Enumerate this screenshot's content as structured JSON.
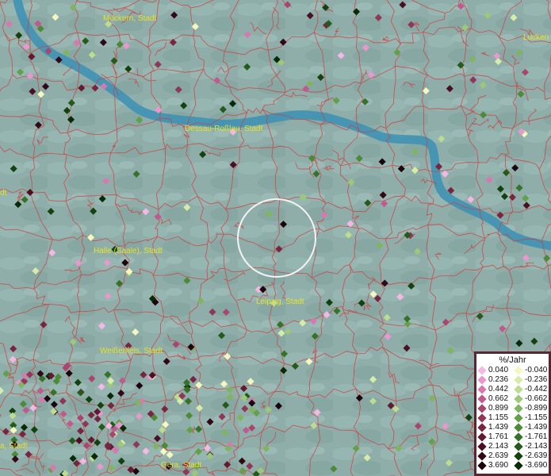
{
  "colors": {
    "terrain": "#8faeaa",
    "river": "#3f92b4",
    "borders": "#d23c3c",
    "label": "#e8e22a",
    "legend_border": "#5a2630"
  },
  "cities": [
    {
      "name": "Möckern, Stadt"
    },
    {
      "name": "Lucken"
    },
    {
      "name": "Dessau-Roßlau, Stadt"
    },
    {
      "name": "Halle (Saale), Stadt"
    },
    {
      "name": "Leipzig, Stadt"
    },
    {
      "name": "Weißenfels, Stadt"
    },
    {
      "name": "Gera, Stadt"
    },
    {
      "name": "a, Stadt"
    },
    {
      "name": "dt"
    }
  ],
  "legend": {
    "title": "%/Jahr",
    "positive": [
      {
        "label": "0.040",
        "color": "#f4b8e4"
      },
      {
        "label": "0.236",
        "color": "#e898cc"
      },
      {
        "label": "0.442",
        "color": "#d878b0"
      },
      {
        "label": "0.662",
        "color": "#c05a8e"
      },
      {
        "label": "0.899",
        "color": "#a84670"
      },
      {
        "label": "1.155",
        "color": "#903656"
      },
      {
        "label": "1.439",
        "color": "#782640"
      },
      {
        "label": "1.761",
        "color": "#621a30"
      },
      {
        "label": "2.143",
        "color": "#4a1022"
      },
      {
        "label": "2.639",
        "color": "#320816"
      },
      {
        "label": "3.690",
        "color": "#1c040c"
      }
    ],
    "negative": [
      {
        "label": "-0.040",
        "color": "#f4f8c0"
      },
      {
        "label": "-0.236",
        "color": "#d8ecaa"
      },
      {
        "label": "-0.442",
        "color": "#bcdc90"
      },
      {
        "label": "-0.662",
        "color": "#9cc878"
      },
      {
        "label": "-0.899",
        "color": "#80b460"
      },
      {
        "label": "-1.155",
        "color": "#64a04a"
      },
      {
        "label": "-1.439",
        "color": "#4c8a38"
      },
      {
        "label": "-1.761",
        "color": "#367228"
      },
      {
        "label": "-2.143",
        "color": "#245a1a"
      },
      {
        "label": "-2.639",
        "color": "#14420e"
      },
      {
        "label": "-3.690",
        "color": "#082a06"
      }
    ]
  }
}
